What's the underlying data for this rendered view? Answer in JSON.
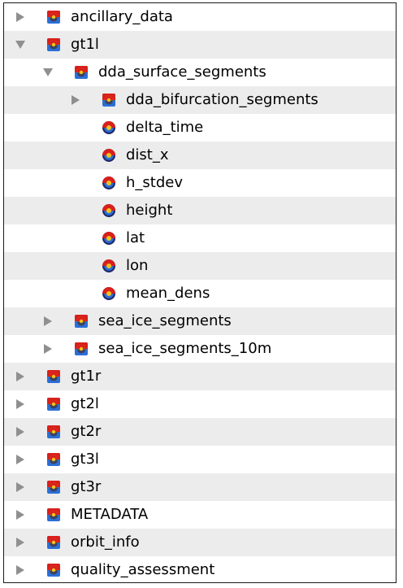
{
  "tree": {
    "rows": [
      {
        "label": "ancillary_data",
        "state": "collapsed",
        "kind": "group",
        "level": 0
      },
      {
        "label": "gt1l",
        "state": "expanded",
        "kind": "group",
        "level": 0
      },
      {
        "label": "dda_surface_segments",
        "state": "expanded",
        "kind": "group",
        "level": 1
      },
      {
        "label": "dda_bifurcation_segments",
        "state": "collapsed",
        "kind": "group",
        "level": 2
      },
      {
        "label": "delta_time",
        "state": "leaf",
        "kind": "dataset",
        "level": 2
      },
      {
        "label": "dist_x",
        "state": "leaf",
        "kind": "dataset",
        "level": 2
      },
      {
        "label": "h_stdev",
        "state": "leaf",
        "kind": "dataset",
        "level": 2
      },
      {
        "label": "height",
        "state": "leaf",
        "kind": "dataset",
        "level": 2
      },
      {
        "label": "lat",
        "state": "leaf",
        "kind": "dataset",
        "level": 2
      },
      {
        "label": "lon",
        "state": "leaf",
        "kind": "dataset",
        "level": 2
      },
      {
        "label": "mean_dens",
        "state": "leaf",
        "kind": "dataset",
        "level": 2
      },
      {
        "label": "sea_ice_segments",
        "state": "collapsed",
        "kind": "group",
        "level": 1
      },
      {
        "label": "sea_ice_segments_10m",
        "state": "collapsed",
        "kind": "group",
        "level": 1
      },
      {
        "label": "gt1r",
        "state": "collapsed",
        "kind": "group",
        "level": 0
      },
      {
        "label": "gt2l",
        "state": "collapsed",
        "kind": "group",
        "level": 0
      },
      {
        "label": "gt2r",
        "state": "collapsed",
        "kind": "group",
        "level": 0
      },
      {
        "label": "gt3l",
        "state": "collapsed",
        "kind": "group",
        "level": 0
      },
      {
        "label": "gt3r",
        "state": "collapsed",
        "kind": "group",
        "level": 0
      },
      {
        "label": "METADATA",
        "state": "collapsed",
        "kind": "group",
        "level": 0
      },
      {
        "label": "orbit_info",
        "state": "collapsed",
        "kind": "group",
        "level": 0
      },
      {
        "label": "quality_assessment",
        "state": "collapsed",
        "kind": "group",
        "level": 0
      }
    ]
  },
  "colors": {
    "row_alt": "#ececec",
    "triangle": "#8f8f8f",
    "icon_red": "#d8201c",
    "icon_yellow": "#f2c21a",
    "icon_blue": "#2b6fd6",
    "icon_dark": "#1f2a6b"
  },
  "icons": {
    "group": "hdf-group-icon",
    "dataset": "hdf-dataset-icon"
  }
}
